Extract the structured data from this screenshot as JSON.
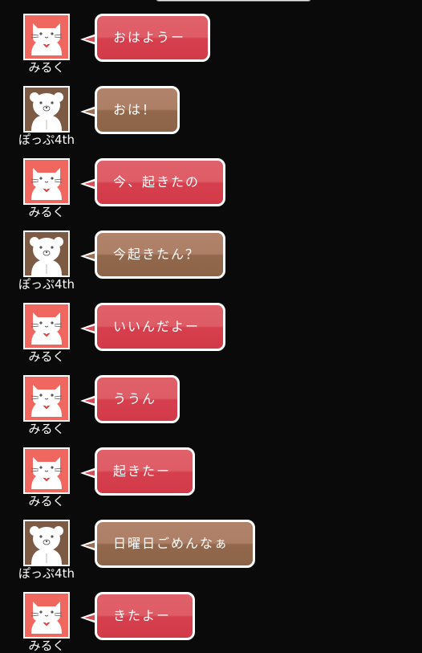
{
  "colors": {
    "background": "#0a0a0a",
    "milk_bubble": "#d84a55",
    "poppu_bubble": "#9a6f54",
    "cat_avatar_bg": "#f0675f",
    "bear_avatar_bg": "#7d5a44"
  },
  "users": {
    "milk": {
      "name": "みるく",
      "avatar_icon": "cat-icon"
    },
    "poppu": {
      "name": "ぽっぷ4th",
      "avatar_icon": "bear-icon"
    }
  },
  "messages": [
    {
      "user": "みるく",
      "text": "おはようー"
    },
    {
      "user": "ぽっぷ4th",
      "text": "おは！"
    },
    {
      "user": "みるく",
      "text": "今、起きたの"
    },
    {
      "user": "ぽっぷ4th",
      "text": "今起きたん？"
    },
    {
      "user": "みるく",
      "text": "いいんだよー"
    },
    {
      "user": "みるく",
      "text": "ううん"
    },
    {
      "user": "みるく",
      "text": "起きたー"
    },
    {
      "user": "ぽっぷ4th",
      "text": "日曜日ごめんなぁ"
    },
    {
      "user": "みるく",
      "text": "きたよー"
    }
  ]
}
